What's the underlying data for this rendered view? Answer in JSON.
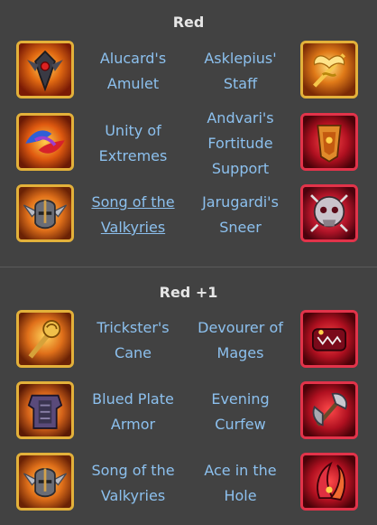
{
  "sections": [
    {
      "title": "Red",
      "rows": [
        {
          "left": {
            "name": "Alucard's Amulet",
            "icon": "amulet-icon",
            "tier": "gold"
          },
          "right": {
            "name": "Asklepius' Staff",
            "icon": "staff-icon",
            "tier": "gold"
          }
        },
        {
          "left": {
            "name": "Unity of Extremes",
            "icon": "extremes-icon",
            "tier": "gold"
          },
          "right": {
            "name": "Andvari's Fortitude Support",
            "icon": "fortitude-icon",
            "tier": "red"
          }
        },
        {
          "left": {
            "name": "Song of the Valkyries",
            "icon": "valkyrie-helm-icon",
            "tier": "gold"
          },
          "right": {
            "name": "Jarugardi's Sneer",
            "icon": "skull-icon",
            "tier": "red"
          }
        }
      ]
    },
    {
      "title": "Red +1",
      "rows": [
        {
          "left": {
            "name": "Trickster's Cane",
            "icon": "cane-icon",
            "tier": "gold"
          },
          "right": {
            "name": "Devourer of Mages",
            "icon": "devourer-icon",
            "tier": "red"
          }
        },
        {
          "left": {
            "name": "Blued Plate Armor",
            "icon": "armor-icon",
            "tier": "gold"
          },
          "right": {
            "name": "Evening Curfew",
            "icon": "axe-icon",
            "tier": "red"
          }
        },
        {
          "left": {
            "name": "Song of the Valkyries",
            "icon": "valkyrie-helm-icon",
            "tier": "gold"
          },
          "right": {
            "name": "Ace in the Hole",
            "icon": "claw-icon",
            "tier": "red"
          }
        }
      ]
    }
  ],
  "colors": {
    "background": "#424242",
    "link": "#8cc0ee",
    "title": "#e6e6e6",
    "gold_frame": "#e3b13a",
    "red_frame": "#e2334a"
  }
}
